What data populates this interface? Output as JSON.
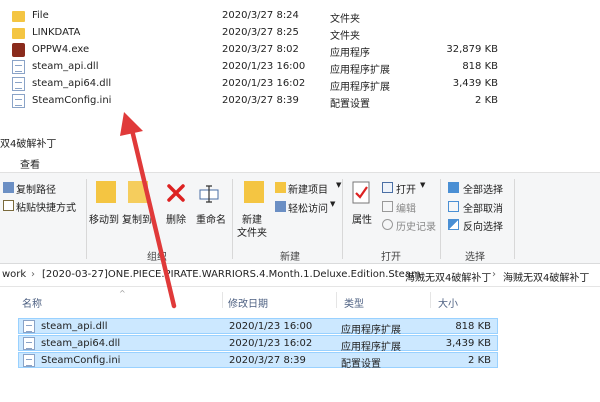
{
  "top_files": [
    {
      "icon": "folder-icon",
      "name": "File",
      "date": "2020/3/27 8:24",
      "type": "文件夹",
      "size": ""
    },
    {
      "icon": "folder-icon",
      "name": "LINKDATA",
      "date": "2020/3/27 8:25",
      "type": "文件夹",
      "size": ""
    },
    {
      "icon": "exe-icon",
      "name": "OPPW4.exe",
      "date": "2020/3/27 8:02",
      "type": "应用程序",
      "size": "32,879 KB"
    },
    {
      "icon": "dll-icon",
      "name": "steam_api.dll",
      "date": "2020/1/23 16:00",
      "type": "应用程序扩展",
      "size": "818 KB"
    },
    {
      "icon": "dll-icon",
      "name": "steam_api64.dll",
      "date": "2020/1/23 16:02",
      "type": "应用程序扩展",
      "size": "3,439 KB"
    },
    {
      "icon": "ini-icon",
      "name": "SteamConfig.ini",
      "date": "2020/3/27 8:39",
      "type": "配置设置",
      "size": "2 KB"
    }
  ],
  "window": {
    "title": "双4破解补丁",
    "menu_view": "查看"
  },
  "ribbon": {
    "copy_path": "复制路径",
    "paste_shortcut": "粘贴快捷方式",
    "move_to": "移动到",
    "copy_to": "复制到",
    "delete": "删除",
    "rename": "重命名",
    "organize_group": "组织",
    "new_folder_line1": "新建",
    "new_folder_line2": "文件夹",
    "new_item": "新建项目",
    "easy_access": "轻松访问",
    "new_group": "新建",
    "properties": "属性",
    "open": "打开",
    "edit": "编辑",
    "history": "历史记录",
    "open_group": "打开",
    "select_all": "全部选择",
    "select_none": "全部取消",
    "invert_selection": "反向选择",
    "select_group": "选择"
  },
  "address": {
    "crumbs": [
      "work",
      "[2020-03-27]ONE.PIECE.PIRATE.WARRIORS.4.Month.1.Deluxe.Edition.Steam",
      "海贼无双4破解补丁",
      "海贼无双4破解补丁"
    ],
    "separator": "›"
  },
  "columns": {
    "name": "名称",
    "date": "修改日期",
    "type": "类型",
    "size": "大小"
  },
  "list_files": [
    {
      "icon": "dll-icon",
      "name": "steam_api.dll",
      "date": "2020/1/23 16:00",
      "type": "应用程序扩展",
      "size": "818 KB"
    },
    {
      "icon": "dll-icon",
      "name": "steam_api64.dll",
      "date": "2020/1/23 16:02",
      "type": "应用程序扩展",
      "size": "3,439 KB"
    },
    {
      "icon": "ini-icon",
      "name": "SteamConfig.ini",
      "date": "2020/3/27 8:39",
      "type": "配置设置",
      "size": "2 KB"
    }
  ],
  "colors": {
    "arrow": "#e03a3a",
    "selection": "#cce8ff",
    "folder": "#f4c542"
  }
}
